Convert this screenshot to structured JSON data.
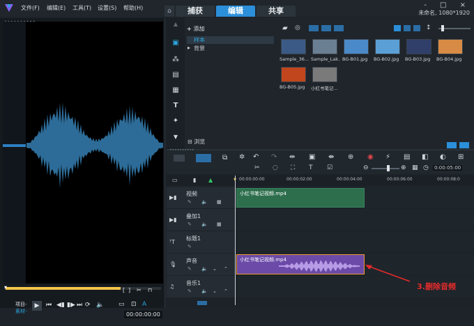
{
  "menubar": {
    "items": [
      "文件(F)",
      "编辑(E)",
      "工具(T)",
      "设置(S)",
      "帮助(H)"
    ],
    "window_controls": "- □ ×"
  },
  "tabs": {
    "items": [
      "捕获",
      "编辑",
      "共享"
    ],
    "active": 1
  },
  "project_info": "未命名, 1080*1920",
  "player": {
    "mode_project": "项目-",
    "mode_clip": "素材-",
    "timecode": "00:00:00:00"
  },
  "library": {
    "add_label": "添加",
    "folders": [
      "样本",
      "背景"
    ],
    "browse_label": "浏览",
    "thumbnails": [
      {
        "label": "Sample_36...",
        "color": "#3b5a86"
      },
      {
        "label": "Sample_Lak...",
        "color": "#6b7f93"
      },
      {
        "label": "BG-B01.jpg",
        "color": "#4b8ac9"
      },
      {
        "label": "BG-B02.jpg",
        "color": "#5aa0d6"
      },
      {
        "label": "BG-B03.jpg",
        "color": "#2f3f6a"
      },
      {
        "label": "BG-B04.jpg",
        "color": "#d88b44"
      },
      {
        "label": "BG-B05.jpg",
        "color": "#c2461d"
      },
      {
        "label": "小红书笔记...",
        "color": "#7a7a7a"
      }
    ]
  },
  "timeline": {
    "zoom_timecode": "0:00:05:00",
    "ruler": [
      "00:00:00:00",
      "00:00:02:00",
      "00:00:04:00",
      "00:00:06:00",
      "00:00:08:0"
    ],
    "tracks": [
      {
        "name": "视频",
        "clip": "小红书笔记视频.mp4"
      },
      {
        "name": "叠加1",
        "clip": ""
      },
      {
        "name": "标题1",
        "clip": ""
      },
      {
        "name": "声音",
        "clip": "小红书笔记视频.mp4"
      },
      {
        "name": "音乐1",
        "clip": ""
      }
    ]
  },
  "annotation": "3.删除音频"
}
